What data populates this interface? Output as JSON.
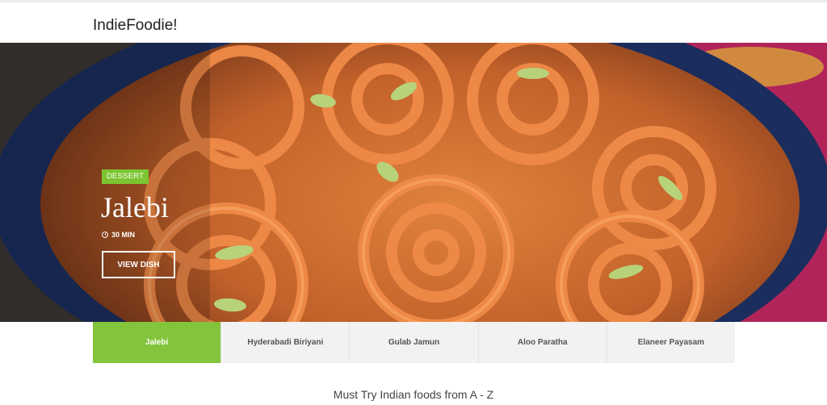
{
  "header": {
    "brand": "IndieFoodie!"
  },
  "hero": {
    "category": "DESSERT",
    "title": "Jalebi",
    "time": "30 MIN",
    "time_icon": "clock-icon",
    "button_label": "VIEW DISH",
    "image": "jalebi-bowl-photo"
  },
  "tabs": [
    {
      "label": "Jalebi",
      "active": true
    },
    {
      "label": "Hyderabadi Biriyani",
      "active": false
    },
    {
      "label": "Gulab Jamun",
      "active": false
    },
    {
      "label": "Aloo Paratha",
      "active": false
    },
    {
      "label": "Elaneer Payasam",
      "active": false
    }
  ],
  "section": {
    "subtitle": "Must Try Indian foods from A - Z"
  },
  "colors": {
    "accent": "#82c43c",
    "tab_bg": "#f2f2f2"
  }
}
